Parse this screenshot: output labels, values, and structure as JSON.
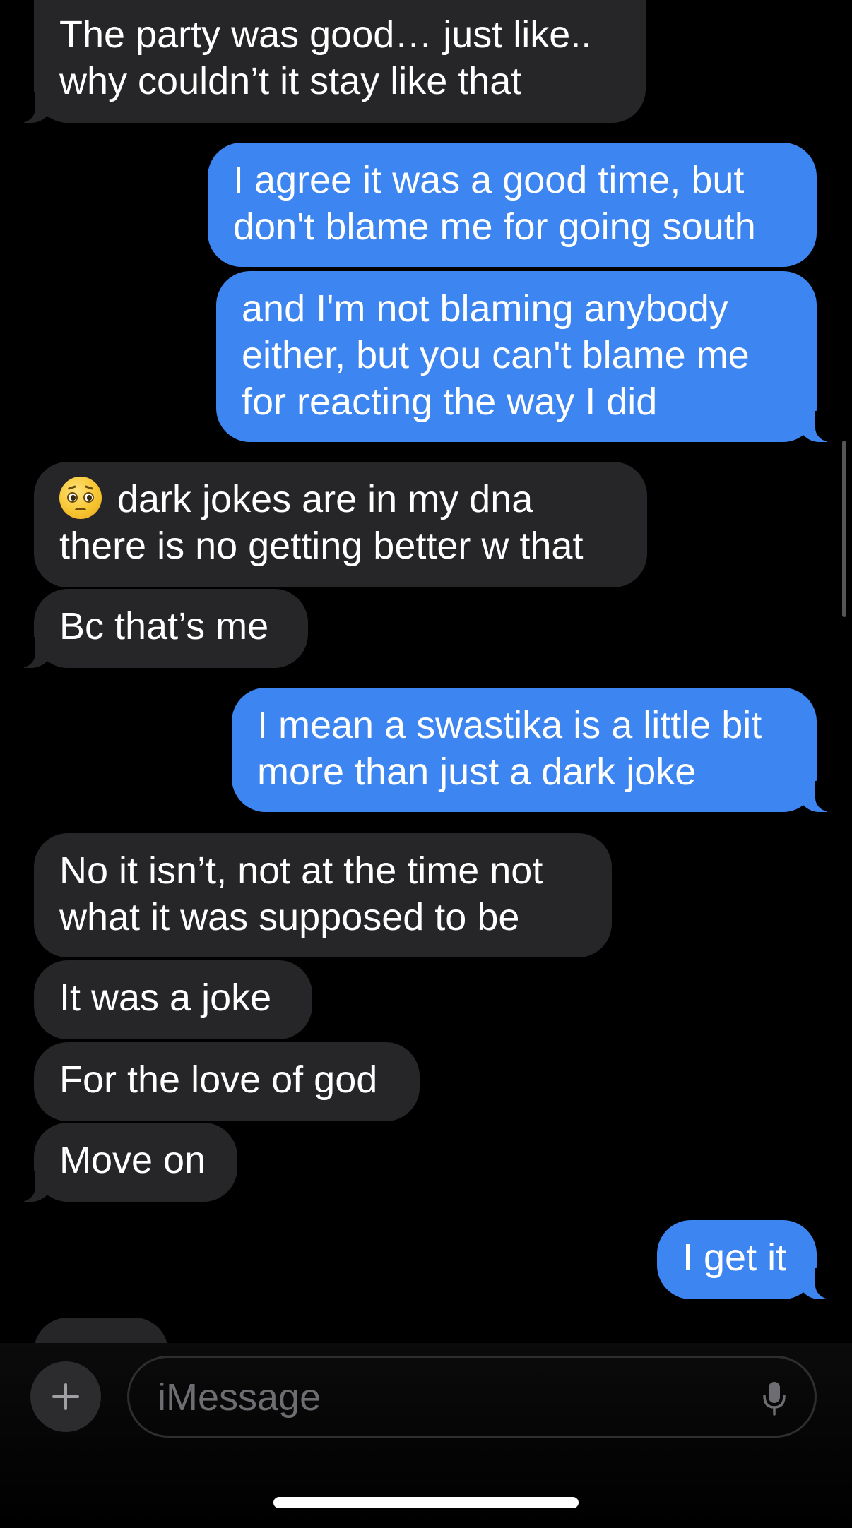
{
  "messages": [
    {
      "side": "received",
      "lines": [
        "The party was good… just like..",
        "why couldn’t it stay like that"
      ]
    },
    {
      "side": "sent",
      "lines": [
        "I agree it was a good time, but",
        "don't blame me for going south"
      ]
    },
    {
      "side": "sent",
      "lines": [
        "and I'm not blaming anybody",
        "either, but you can't blame me",
        "for reacting the way I did"
      ]
    },
    {
      "side": "received",
      "emoji": "pleading-face",
      "lines": [
        "dark jokes are in my dna",
        "there is no getting better w that"
      ]
    },
    {
      "side": "received",
      "lines": [
        "Bc that’s me"
      ]
    },
    {
      "side": "sent",
      "lines": [
        "I mean a swastika is a little bit",
        "more than just a dark joke"
      ]
    },
    {
      "side": "received",
      "lines": [
        "No it isn’t, not at the time not",
        "what it was supposed to be"
      ]
    },
    {
      "side": "received",
      "lines": [
        "It was a joke"
      ]
    },
    {
      "side": "received",
      "lines": [
        "For the love of god"
      ]
    },
    {
      "side": "received",
      "lines": [
        "Move on"
      ]
    },
    {
      "side": "sent",
      "lines": [
        "I get it"
      ]
    }
  ],
  "compose": {
    "placeholder": "iMessage",
    "add_icon": "plus-icon",
    "mic_icon": "microphone-icon"
  },
  "colors": {
    "background": "#000000",
    "received_bubble": "#262628",
    "sent_bubble": "#3d85f0",
    "text": "#ffffff",
    "placeholder": "#6d6d72"
  }
}
